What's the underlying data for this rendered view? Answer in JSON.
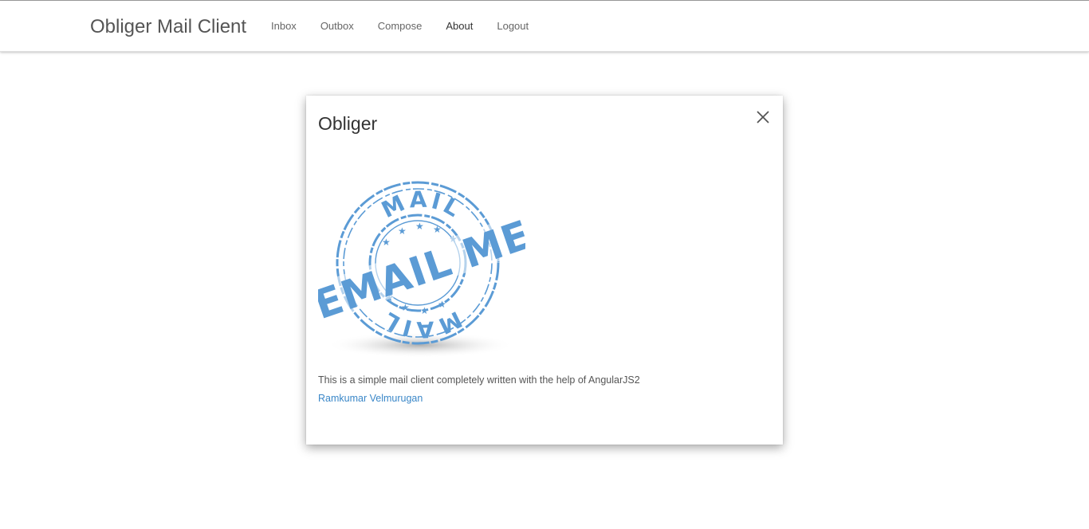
{
  "navbar": {
    "brand": "Obliger Mail Client",
    "items": [
      {
        "label": "Inbox"
      },
      {
        "label": "Outbox"
      },
      {
        "label": "Compose"
      },
      {
        "label": "About"
      },
      {
        "label": "Logout"
      }
    ],
    "active": "About"
  },
  "modal": {
    "title": "Obliger",
    "stamp_text": {
      "top": "MAIL",
      "center": "EMAIL ME",
      "bottom": "MAIL"
    },
    "description": "This is a simple mail client completely written with the help of AngularJS2",
    "author": "Ramkumar Velmurugan"
  },
  "colors": {
    "stamp_blue": "#5b9bd5",
    "link_blue": "#3a87c8",
    "brand_text": "#555555"
  },
  "icons": {
    "close": "close-icon"
  }
}
